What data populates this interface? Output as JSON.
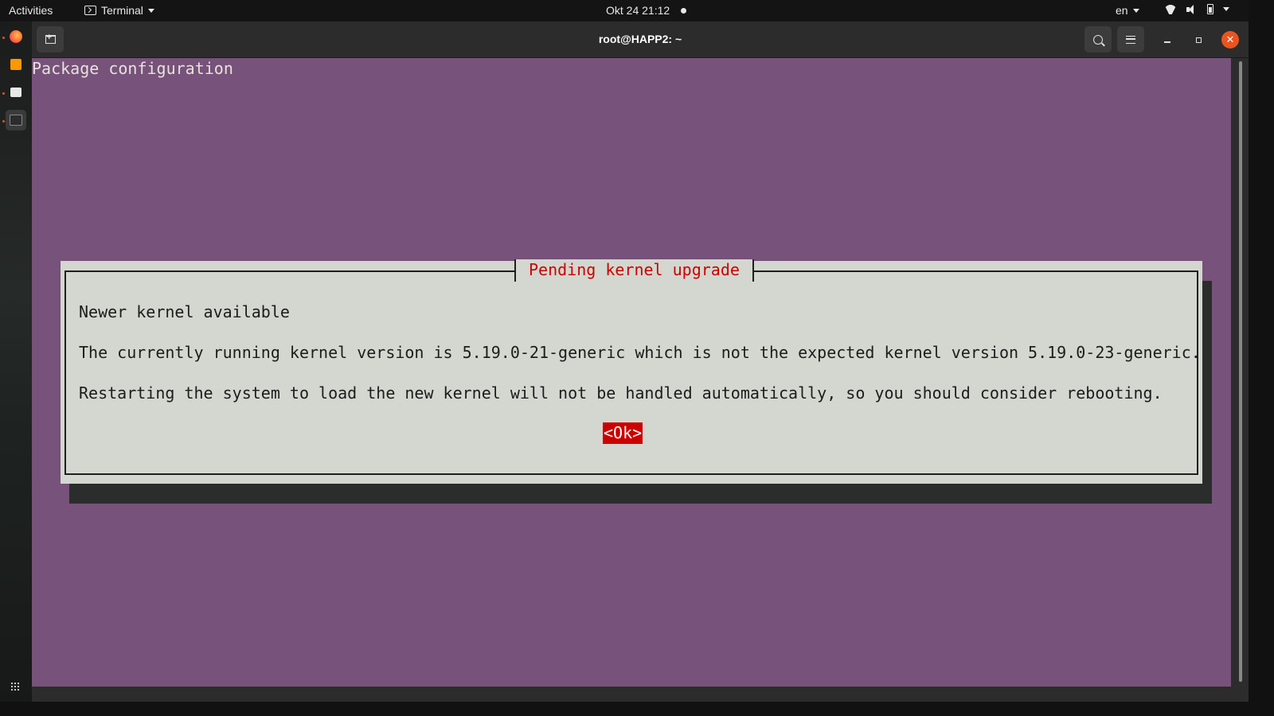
{
  "topbar": {
    "activities": "Activities",
    "app_name": "Terminal",
    "datetime": "Okt 24  21:12",
    "language": "en"
  },
  "dock": {
    "items": [
      "firefox-icon",
      "sublime-text-icon",
      "files-icon",
      "terminal-icon"
    ],
    "show_apps_icon": "grid-icon"
  },
  "window": {
    "title": "root@HAPP2: ~",
    "close_glyph": "✕"
  },
  "terminal": {
    "header_text": "Package configuration",
    "dialog": {
      "title": "Pending kernel upgrade",
      "line1": "Newer kernel available",
      "line2": "The currently running kernel version is 5.19.0-21-generic which is not the expected kernel version 5.19.0-23-generic.",
      "line3": "Restarting the system to load the new kernel will not be handled automatically, so you should consider rebooting.",
      "ok_button": "<Ok>"
    },
    "colors": {
      "background": "#77527a",
      "dialog_bg": "#d3d7cf",
      "title_red": "#cc0000"
    }
  }
}
